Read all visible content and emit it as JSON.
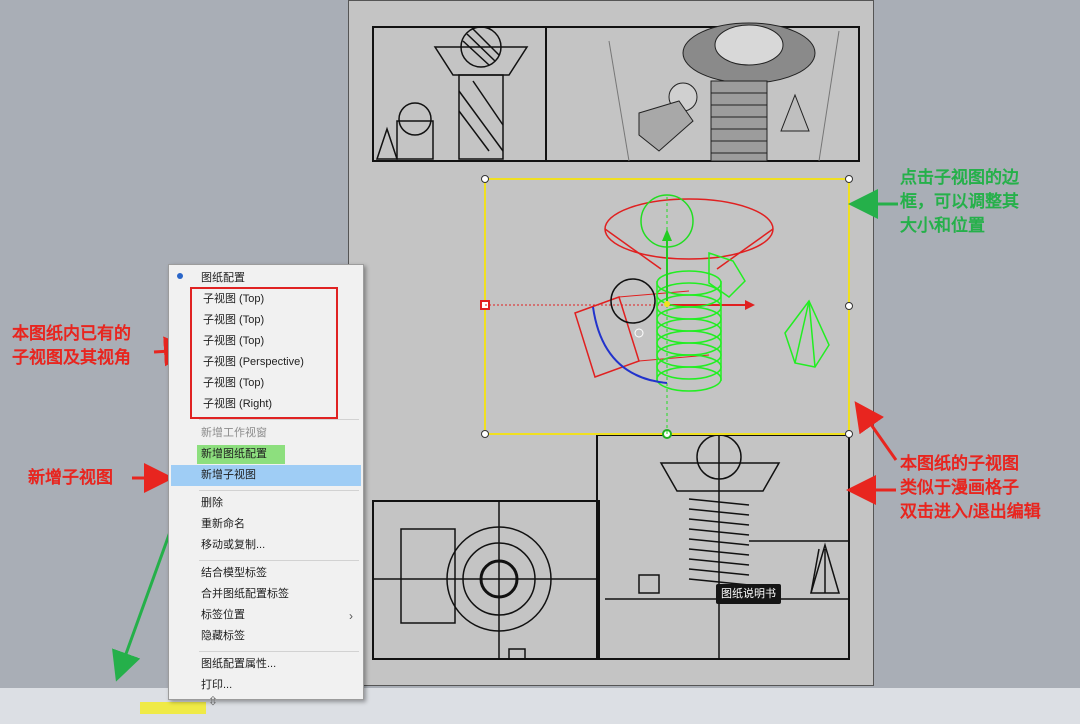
{
  "menu": {
    "items": [
      {
        "label": "图纸配置"
      },
      {
        "label": "子视图 (Top)"
      },
      {
        "label": "子视图 (Top)"
      },
      {
        "label": "子视图 (Top)"
      },
      {
        "label": "子视图 (Perspective)"
      },
      {
        "label": "子视图 (Top)"
      },
      {
        "label": "子视图 (Right)"
      },
      {
        "label": "新增工作视窗"
      },
      {
        "label": "新增图纸配置"
      },
      {
        "label": "新增子视图"
      },
      {
        "label": "删除"
      },
      {
        "label": "重新命名"
      },
      {
        "label": "移动或复制..."
      },
      {
        "label": "结合模型标签"
      },
      {
        "label": "合并图纸配置标签"
      },
      {
        "label": "标签位置"
      },
      {
        "label": "隐藏标签"
      },
      {
        "label": "图纸配置属性..."
      },
      {
        "label": "打印..."
      }
    ]
  },
  "annotations": {
    "existing_views": [
      "本图纸内已有的",
      "子视图及其视角"
    ],
    "add_view": "新增子视图",
    "border_hint": [
      "点击子视图的边",
      "框，可以调整其",
      "大小和位置"
    ],
    "panel_hint": [
      "本图纸的子视图",
      "类似于漫画格子",
      "双击进入/退出编辑"
    ]
  },
  "tooltip": "图纸说明书",
  "colors": {
    "annotation_red": "#e8251f",
    "annotation_green": "#25b04a",
    "selection_yellow": "#f0e020",
    "menu_highlight": "#9fcdf5"
  }
}
